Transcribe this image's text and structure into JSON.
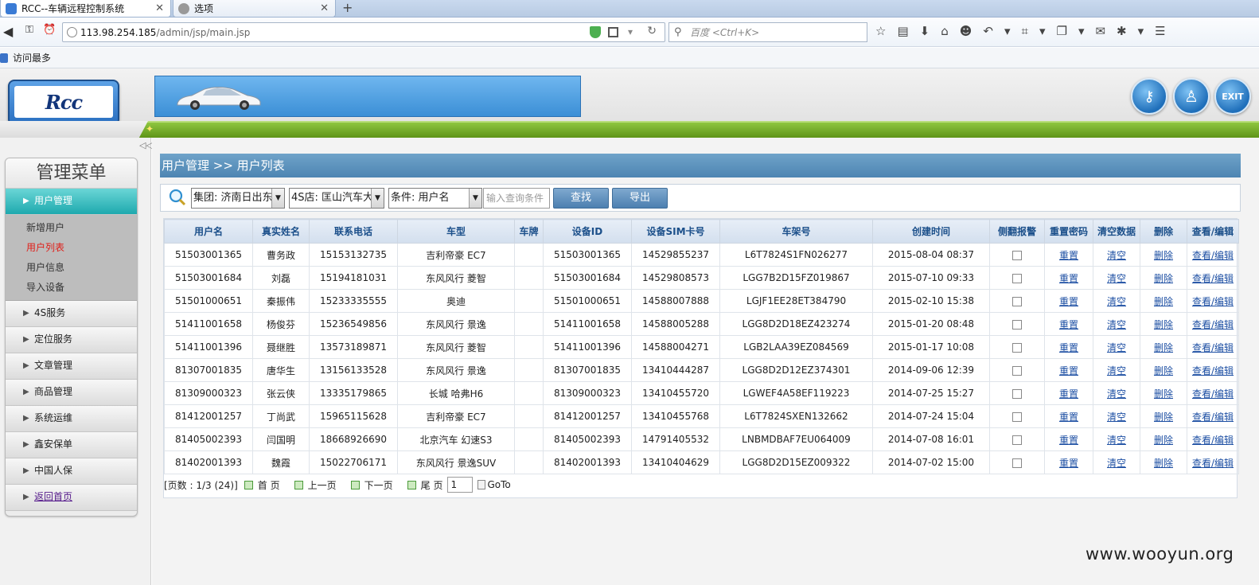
{
  "browser": {
    "tabs": [
      {
        "label": "RCC--车辆远程控制系统",
        "active": true
      },
      {
        "label": "选项",
        "active": false
      }
    ],
    "url_host": "113.98.254.185",
    "url_path": "/admin/jsp/main.jsp",
    "search_placeholder": "百度 <Ctrl+K>",
    "bookmark": "访问最多"
  },
  "header": {
    "logo_text": "Rcc",
    "exit_label": "EXIT"
  },
  "sidebar": {
    "title": "管理菜单",
    "items": [
      {
        "label": "用户管理",
        "active": true,
        "children": [
          {
            "label": "新增用户",
            "current": false
          },
          {
            "label": "用户列表",
            "current": true
          },
          {
            "label": "用户信息",
            "current": false
          },
          {
            "label": "导入设备",
            "current": false
          }
        ]
      },
      {
        "label": "4S服务"
      },
      {
        "label": "定位服务"
      },
      {
        "label": "文章管理"
      },
      {
        "label": "商品管理"
      },
      {
        "label": "系统运维"
      },
      {
        "label": "鑫安保单"
      },
      {
        "label": "中国人保"
      },
      {
        "label": "返回首页",
        "link": true
      }
    ]
  },
  "breadcrumb": "用户管理 >> 用户列表",
  "search": {
    "group": "集团: 济南日出东",
    "shop": "4S店: 匡山汽车大",
    "condition": "条件: 用户名",
    "query_placeholder": "输入查询条件",
    "find_label": "查找",
    "export_label": "导出"
  },
  "table": {
    "headers": [
      "用户名",
      "真实姓名",
      "联系电话",
      "车型",
      "车牌",
      "设备ID",
      "设备SIM卡号",
      "车架号",
      "创建时间",
      "侧翻报警",
      "重置密码",
      "清空数据",
      "删除",
      "查看/编辑"
    ],
    "action_labels": {
      "reset": "重置",
      "clear": "清空",
      "delete": "删除",
      "edit": "查看/编辑"
    },
    "rows": [
      {
        "username": "51503001365",
        "name": "曹务政",
        "phone": "15153132735",
        "model": "吉利帝豪 EC7",
        "plate": "",
        "device_id": "51503001365",
        "sim": "14529855237",
        "vin": "L6T7824S1FN026277",
        "created": "2015-08-04 08:37"
      },
      {
        "username": "51503001684",
        "name": "刘磊",
        "phone": "15194181031",
        "model": "东风风行 菱智",
        "plate": "",
        "device_id": "51503001684",
        "sim": "14529808573",
        "vin": "LGG7B2D15FZ019867",
        "created": "2015-07-10 09:33"
      },
      {
        "username": "51501000651",
        "name": "秦振伟",
        "phone": "15233335555",
        "model": "奥迪",
        "plate": "",
        "device_id": "51501000651",
        "sim": "14588007888",
        "vin": "LGJF1EE28ET384790",
        "created": "2015-02-10 15:38"
      },
      {
        "username": "51411001658",
        "name": "杨俊芬",
        "phone": "15236549856",
        "model": "东风风行 景逸",
        "plate": "",
        "device_id": "51411001658",
        "sim": "14588005288",
        "vin": "LGG8D2D18EZ423274",
        "created": "2015-01-20 08:48"
      },
      {
        "username": "51411001396",
        "name": "聂继胜",
        "phone": "13573189871",
        "model": "东风风行 菱智",
        "plate": "",
        "device_id": "51411001396",
        "sim": "14588004271",
        "vin": "LGB2LAA39EZ084569",
        "created": "2015-01-17 10:08"
      },
      {
        "username": "81307001835",
        "name": "唐华生",
        "phone": "13156133528",
        "model": "东风风行 景逸",
        "plate": "",
        "device_id": "81307001835",
        "sim": "13410444287",
        "vin": "LGG8D2D12EZ374301",
        "created": "2014-09-06 12:39"
      },
      {
        "username": "81309000323",
        "name": "张云侠",
        "phone": "13335179865",
        "model": "长城 哈弗H6",
        "plate": "",
        "device_id": "81309000323",
        "sim": "13410455720",
        "vin": "LGWEF4A58EF119223",
        "created": "2014-07-25 15:27"
      },
      {
        "username": "81412001257",
        "name": "丁尚武",
        "phone": "15965115628",
        "model": "吉利帝豪 EC7",
        "plate": "",
        "device_id": "81412001257",
        "sim": "13410455768",
        "vin": "L6T7824SXEN132662",
        "created": "2014-07-24 15:04"
      },
      {
        "username": "81405002393",
        "name": "闫国明",
        "phone": "18668926690",
        "model": "北京汽车 幻速S3",
        "plate": "",
        "device_id": "81405002393",
        "sim": "14791405532",
        "vin": "LNBMDBAF7EU064009",
        "created": "2014-07-08 16:01"
      },
      {
        "username": "81402001393",
        "name": "魏霞",
        "phone": "15022706171",
        "model": "东风风行 景逸SUV",
        "plate": "",
        "device_id": "81402001393",
        "sim": "13410404629",
        "vin": "LGG8D2D15EZ009322",
        "created": "2014-07-02 15:00"
      }
    ]
  },
  "pager": {
    "info": "[页数 : 1/3 (24)]",
    "first": "首 页",
    "prev": "上一页",
    "next": "下一页",
    "last": "尾 页",
    "page_value": "1",
    "goto": "GoTo"
  },
  "watermark": "www.wooyun.org",
  "colors": {
    "accent": "#4d85b2",
    "menu_active": "#1ea9ae",
    "green_bar": "#6fa826"
  }
}
